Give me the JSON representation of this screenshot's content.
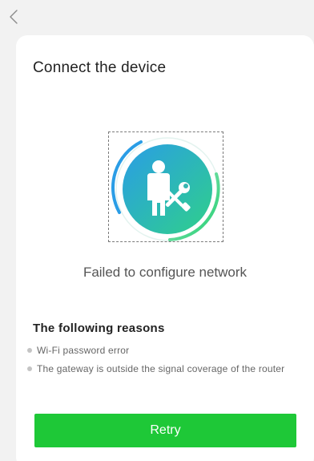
{
  "nav": {
    "back_icon": "chevron-left-icon"
  },
  "card": {
    "title": "Connect the device",
    "illustration_icon": "technician-with-tools-icon",
    "status": "Failed to configure network",
    "reasons_title": "The following reasons",
    "reasons": [
      "Wi-Fi password error",
      "The gateway is outside the signal coverage of the router"
    ],
    "retry_label": "Retry"
  },
  "colors": {
    "background": "#f2f2f2",
    "card": "#ffffff",
    "accent_green": "#1ec837",
    "illustration_blue": "#2a9de6",
    "illustration_green": "#2fd08a"
  }
}
